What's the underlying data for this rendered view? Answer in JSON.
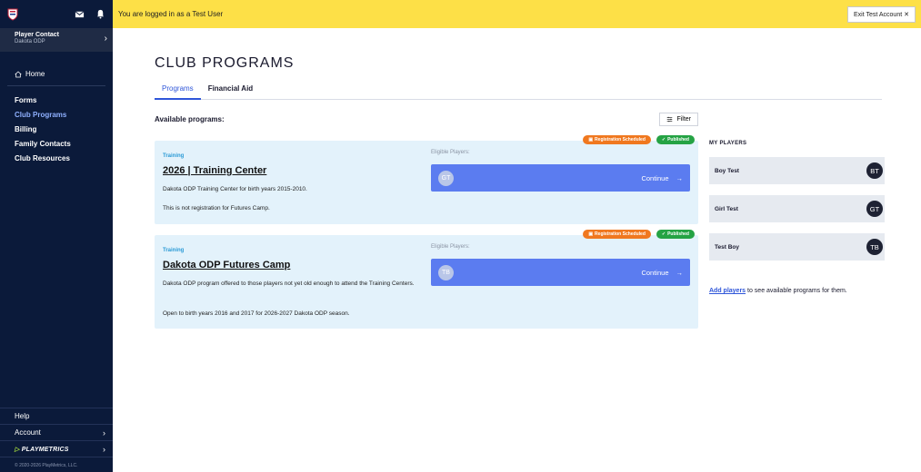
{
  "sidebar": {
    "contact_name": "Player Contact",
    "contact_org": "Dakota ODP",
    "home": "Home",
    "nav": [
      "Forms",
      "Club Programs",
      "Billing",
      "Family Contacts",
      "Club Resources"
    ],
    "active_nav": "Club Programs",
    "help": "Help",
    "account": "Account",
    "brand": "PLAYMETRICS",
    "copyright": "© 2020-2026 PlayMetrics, LLC."
  },
  "banner": {
    "message": "You are logged in as a Test User",
    "exit_label": "Exit Test Account"
  },
  "page": {
    "title": "CLUB PROGRAMS",
    "tabs": [
      "Programs",
      "Financial Aid"
    ],
    "active_tab": "Programs",
    "available_label": "Available programs:",
    "filter_label": "Filter"
  },
  "programs": [
    {
      "category": "Training",
      "title": "2026 | Training Center",
      "desc1": "Dakota ODP Training Center for birth years 2015-2010.",
      "desc2": "This is not registration for Futures Camp.",
      "eligible_label": "Eligible Players:",
      "player_initials": "GT",
      "continue_label": "Continue",
      "badge_scheduled": "Registration Scheduled",
      "badge_published": "Published"
    },
    {
      "category": "Training",
      "title": "Dakota ODP Futures Camp",
      "desc1": "Dakota ODP program offered to those players not yet old enough to attend the Training Centers.",
      "desc2": "Open to birth years 2016 and 2017 for 2026-2027 Dakota ODP season.",
      "eligible_label": "Eligible Players:",
      "player_initials": "TB",
      "continue_label": "Continue",
      "badge_scheduled": "Registration Scheduled",
      "badge_published": "Published"
    }
  ],
  "my_players": {
    "heading": "MY PLAYERS",
    "players": [
      {
        "name": "Boy Test",
        "initials": "BT"
      },
      {
        "name": "Girl Test",
        "initials": "GT"
      },
      {
        "name": "Test Boy",
        "initials": "TB"
      }
    ],
    "add_link": "Add players",
    "add_rest": " to see available programs for them."
  },
  "colors": {
    "sidebar_bg": "#0b1a3a",
    "banner_bg": "#fde047",
    "accent": "#2f56d9",
    "card_bg": "#e3f2fb",
    "continue_bg": "#5b7cf0",
    "badge_scheduled": "#f0781f",
    "badge_published": "#25a344"
  }
}
